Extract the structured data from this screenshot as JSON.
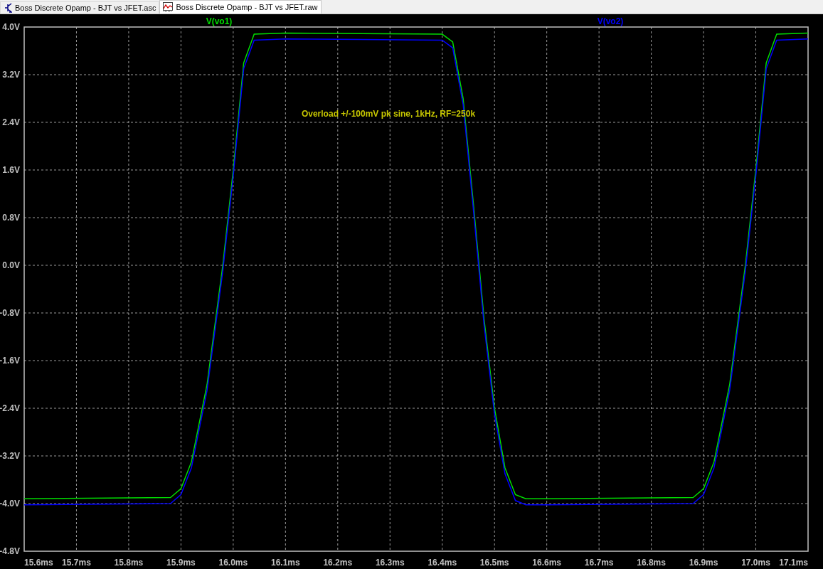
{
  "tabs": [
    {
      "label": "Boss Discrete Opamp - BJT vs JFET.asc",
      "kind": "schematic",
      "selected": false
    },
    {
      "label": "Boss Discrete Opamp - BJT vs JFET.raw",
      "kind": "waveform",
      "selected": true
    }
  ],
  "plot": {
    "chart_data": {
      "type": "line",
      "x": [
        15.6,
        15.88,
        15.9,
        15.92,
        15.95,
        15.98,
        16.0,
        16.02,
        16.04,
        16.1,
        16.4,
        16.42,
        16.44,
        16.46,
        16.48,
        16.5,
        16.52,
        16.54,
        16.56,
        16.6,
        16.88,
        16.9,
        16.92,
        16.95,
        16.98,
        17.0,
        17.02,
        17.04,
        17.1
      ],
      "series": [
        {
          "name": "V(vo1)",
          "color": "#00dd00",
          "values": [
            -3.92,
            -3.9,
            -3.75,
            -3.3,
            -2.0,
            0.0,
            1.6,
            3.4,
            3.88,
            3.9,
            3.88,
            3.75,
            2.8,
            1.0,
            -0.9,
            -2.4,
            -3.4,
            -3.85,
            -3.92,
            -3.92,
            -3.9,
            -3.75,
            -3.3,
            -2.0,
            0.0,
            1.6,
            3.4,
            3.88,
            3.9
          ]
        },
        {
          "name": "V(vo2)",
          "color": "#0000ff",
          "values": [
            -4.02,
            -4.0,
            -3.85,
            -3.4,
            -2.1,
            -0.1,
            1.5,
            3.3,
            3.78,
            3.8,
            3.78,
            3.65,
            2.7,
            0.9,
            -1.0,
            -2.5,
            -3.5,
            -3.95,
            -4.02,
            -4.02,
            -4.0,
            -3.85,
            -3.4,
            -2.1,
            -0.1,
            1.5,
            3.3,
            3.78,
            3.8
          ]
        }
      ],
      "xlim": [
        15.6,
        17.1
      ],
      "ylim": [
        -4.8,
        4.0
      ],
      "xticks": [
        {
          "value": 15.6,
          "label": "15.6ms"
        },
        {
          "value": 15.7,
          "label": "15.7ms"
        },
        {
          "value": 15.8,
          "label": "15.8ms"
        },
        {
          "value": 15.9,
          "label": "15.9ms"
        },
        {
          "value": 16.0,
          "label": "16.0ms"
        },
        {
          "value": 16.1,
          "label": "16.1ms"
        },
        {
          "value": 16.2,
          "label": "16.2ms"
        },
        {
          "value": 16.3,
          "label": "16.3ms"
        },
        {
          "value": 16.4,
          "label": "16.4ms"
        },
        {
          "value": 16.5,
          "label": "16.5ms"
        },
        {
          "value": 16.6,
          "label": "16.6ms"
        },
        {
          "value": 16.7,
          "label": "16.7ms"
        },
        {
          "value": 16.8,
          "label": "16.8ms"
        },
        {
          "value": 16.9,
          "label": "16.9ms"
        },
        {
          "value": 17.0,
          "label": "17.0ms"
        },
        {
          "value": 17.1,
          "label": "17.1ms"
        }
      ],
      "yticks": [
        {
          "value": 4.0,
          "label": "4.0V"
        },
        {
          "value": 3.2,
          "label": "3.2V"
        },
        {
          "value": 2.4,
          "label": "2.4V"
        },
        {
          "value": 1.6,
          "label": "1.6V"
        },
        {
          "value": 0.8,
          "label": "0.8V"
        },
        {
          "value": 0.0,
          "label": "0.0V"
        },
        {
          "value": -0.8,
          "label": "-0.8V"
        },
        {
          "value": -1.6,
          "label": "-1.6V"
        },
        {
          "value": -2.4,
          "label": "-2.4V"
        },
        {
          "value": -3.2,
          "label": "-3.2V"
        },
        {
          "value": -4.0,
          "label": "-4.0V"
        },
        {
          "value": -4.8,
          "label": "-4.8V"
        }
      ],
      "grid": true,
      "annotations": [
        "Overload +/-100mV pk sine, 1kHz, RF=250k"
      ]
    }
  }
}
